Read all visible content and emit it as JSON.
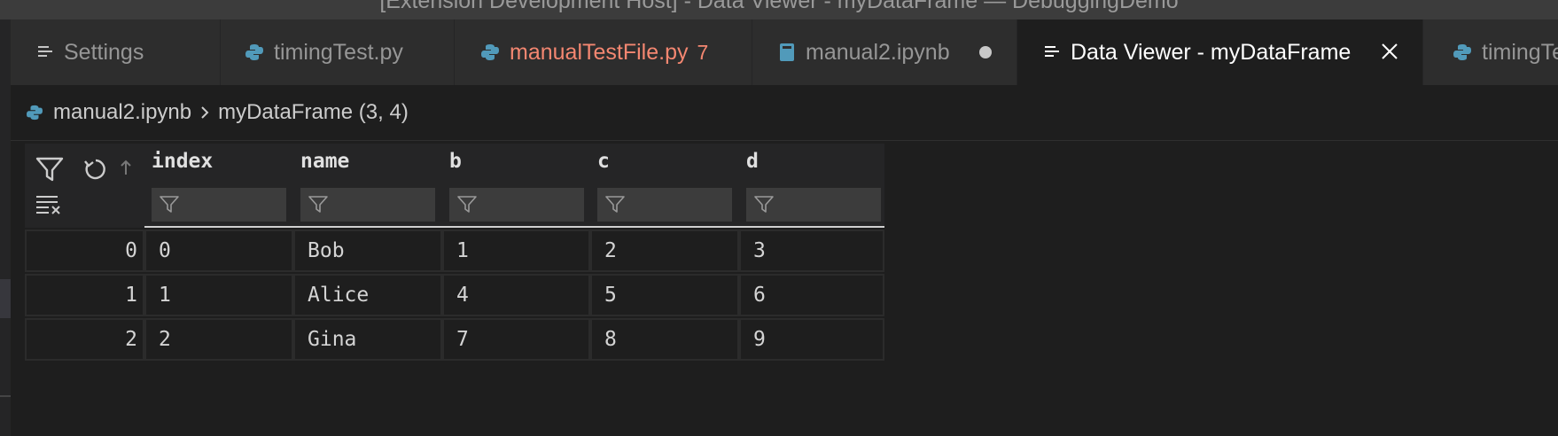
{
  "window": {
    "title": "[Extension Development Host] - Data Viewer - myDataFrame — DebuggingDemo"
  },
  "tabs": [
    {
      "label": "Settings",
      "icon": "settings-icon"
    },
    {
      "label": "timingTest.py",
      "icon": "python-icon"
    },
    {
      "label": "manualTestFile.py",
      "icon": "python-icon",
      "badge": "7"
    },
    {
      "label": "manual2.ipynb",
      "icon": "notebook-icon"
    },
    {
      "label": "Data Viewer - myDataFrame",
      "icon": "preview-icon"
    },
    {
      "label": "timingTest.py",
      "icon": "python-icon"
    }
  ],
  "breadcrumb": {
    "file": "manual2.ipynb",
    "item": "myDataFrame (3, 4)"
  },
  "grid": {
    "columns": [
      "index",
      "name",
      "b",
      "c",
      "d"
    ],
    "rows": [
      {
        "row_index": "0",
        "cells": [
          "0",
          "Bob",
          "1",
          "2",
          "3"
        ]
      },
      {
        "row_index": "1",
        "cells": [
          "1",
          "Alice",
          "4",
          "5",
          "6"
        ]
      },
      {
        "row_index": "2",
        "cells": [
          "2",
          "Gina",
          "7",
          "8",
          "9"
        ]
      }
    ]
  },
  "colors": {
    "accent_modified": "#f48771",
    "python_icon": "#519aba",
    "background": "#1e1e1e",
    "tabbar": "#252526"
  }
}
